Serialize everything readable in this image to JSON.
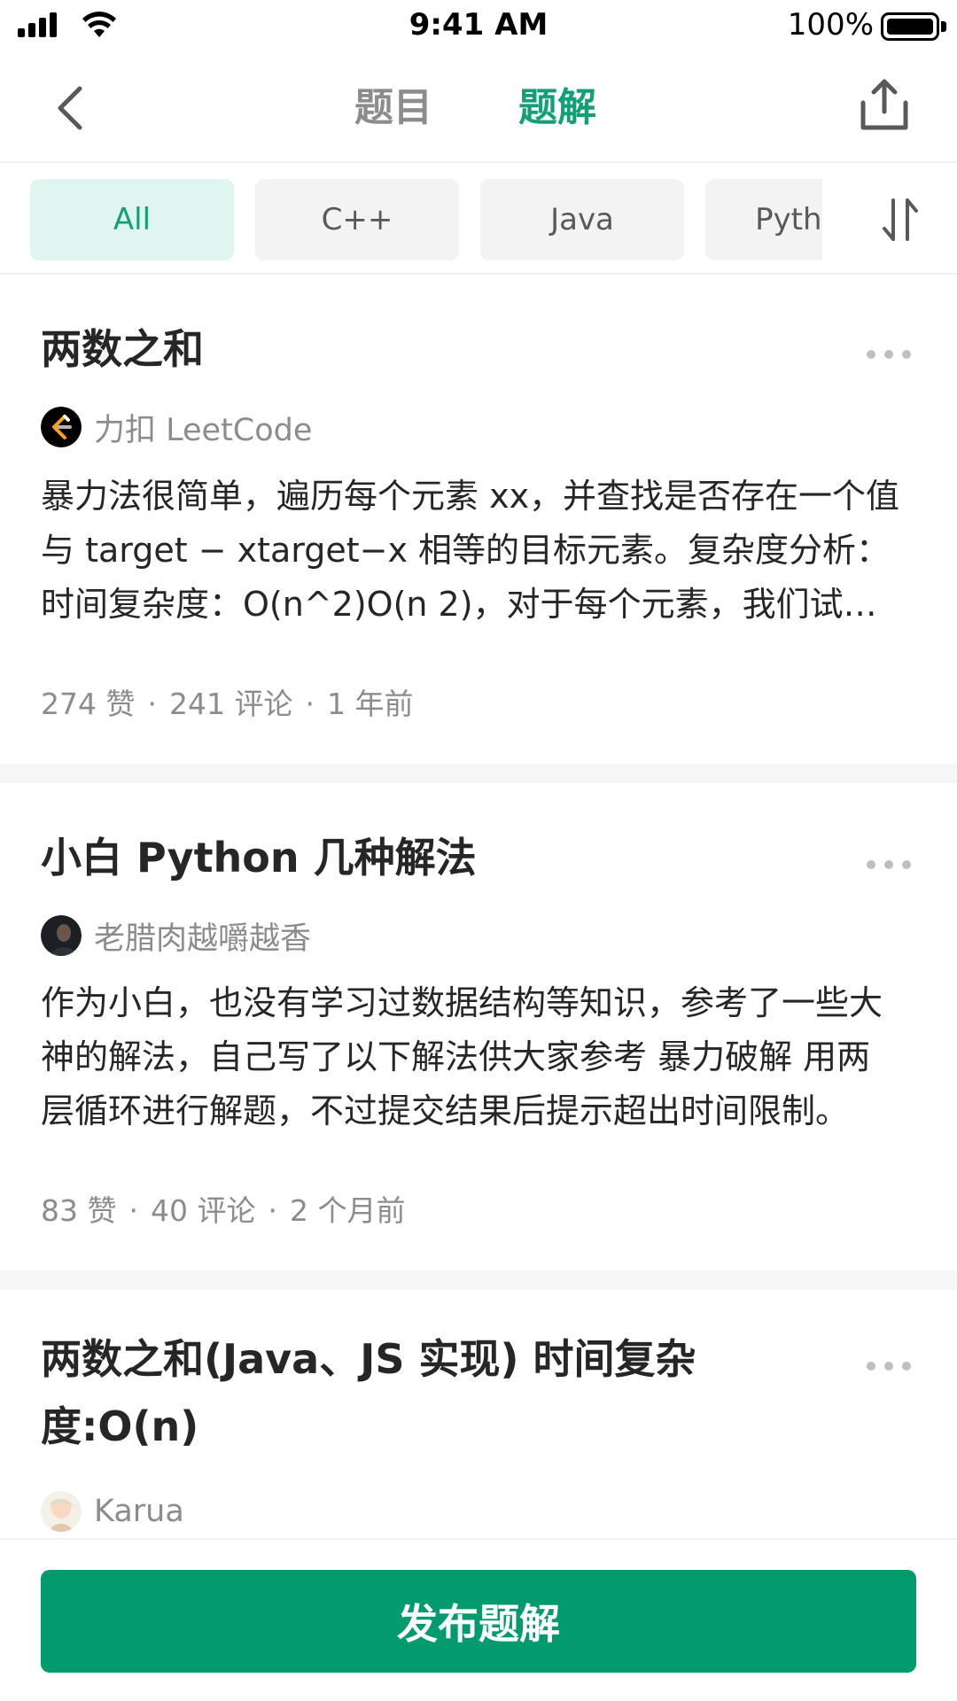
{
  "status_bar": {
    "time": "9:41 AM",
    "battery_percent": "100%",
    "icons": [
      "cellular-signal-icon",
      "wifi-icon",
      "battery-icon"
    ]
  },
  "nav": {
    "back_icon": "chevron-left-icon",
    "tabs": [
      {
        "label": "题目",
        "active": false
      },
      {
        "label": "题解",
        "active": true
      }
    ],
    "share_icon": "share-upload-icon"
  },
  "filters": {
    "chips": [
      {
        "label": "All",
        "active": true
      },
      {
        "label": "C++",
        "active": false
      },
      {
        "label": "Java",
        "active": false
      },
      {
        "label": "Python",
        "active": false
      }
    ],
    "sort_icon": "sort-icon"
  },
  "solutions": [
    {
      "title": "两数之和",
      "author": "力扣 LeetCode",
      "avatar_icon": "leetcode-logo-icon",
      "excerpt": "暴力法很简单，遍历每个元素 xx，并查找是否存在一个值与 target − xtarget−x 相等的目标元素。复杂度分析：时间复杂度：O(n^2)O(n 2)，对于每个元素，我们试图通过遍历数组的其余部分来寻找它所对应的目标元素。",
      "likes": "274 赞",
      "comments": "241 评论",
      "time": "1 年前"
    },
    {
      "title": "小白 Python 几种解法",
      "author": "老腊肉越嚼越香",
      "avatar_icon": "user-avatar-icon",
      "excerpt": "作为小白，也没有学习过数据结构等知识，参考了一些大神的解法，自己写了以下解法供大家参考 暴力破解 用两层循环进行解题，不过提交结果后提示超出时间限制。",
      "likes": "83 赞",
      "comments": "40 评论",
      "time": "2 个月前"
    },
    {
      "title": "两数之和(Java、JS 实现) 时间复杂度:O(n)",
      "author": "Karua",
      "avatar_icon": "user-avatar-icon"
    }
  ],
  "more_icon": "more-dots-icon",
  "bottom": {
    "publish_label": "发布题解"
  },
  "colors": {
    "accent": "#14a076",
    "publish_button": "#019b6e",
    "active_chip_bg": "#e0f5ef",
    "chip_bg": "#f3f3f3",
    "secondary_text": "#8c8c8c"
  }
}
